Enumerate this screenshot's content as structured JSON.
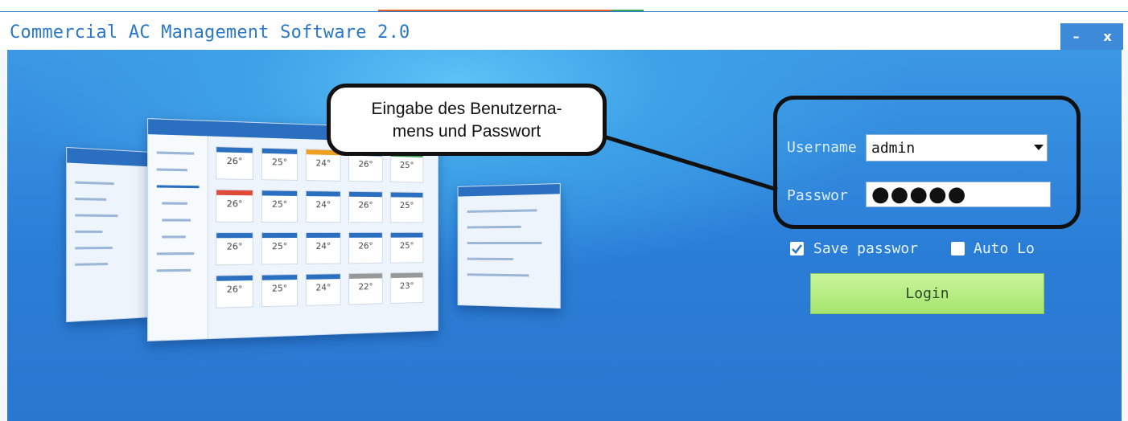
{
  "window": {
    "title": "Commercial AC Management Software 2.0",
    "minimize_label": "–",
    "close_label": "x"
  },
  "callout": {
    "line1": "Eingabe des Benutzerna-",
    "line2": "mens und Passwort"
  },
  "login": {
    "username_label": "Username",
    "username_value": "admin",
    "password_label": "Passwor",
    "password_value": "●●●●●",
    "save_password_label": "Save passwor",
    "save_password_checked": true,
    "auto_login_label": "Auto Lo",
    "auto_login_checked": false,
    "login_button_label": "Login"
  },
  "mockup": {
    "tile_values": [
      "26°",
      "25°",
      "24°",
      "26°",
      "25°",
      "26°",
      "25°",
      "24°",
      "26°",
      "25°",
      "26°",
      "25°",
      "24°",
      "26°",
      "25°",
      "26°",
      "25°",
      "24°",
      "22°",
      "23°"
    ]
  },
  "colors": {
    "accent": "#2a79c9",
    "background_top": "#5cc2f6",
    "background_bottom": "#2a77cf",
    "login_button": "#a6e56e"
  }
}
